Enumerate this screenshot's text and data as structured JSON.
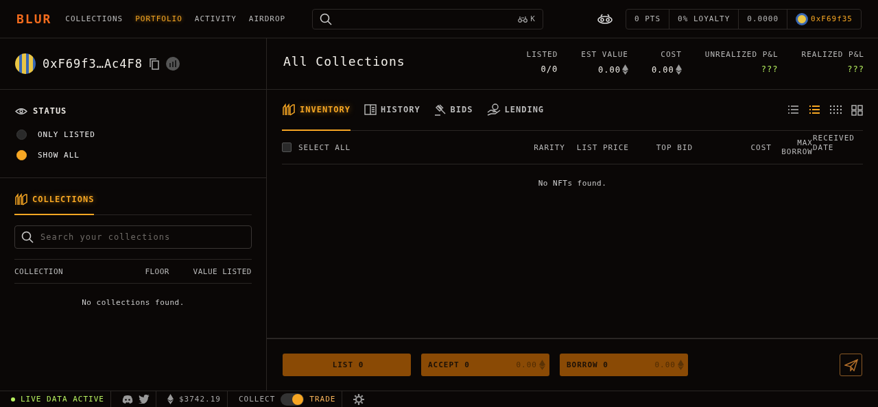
{
  "nav": {
    "logo": "BLUR",
    "links": [
      {
        "label": "COLLECTIONS",
        "selected": false
      },
      {
        "label": "PORTFOLIO",
        "selected": true
      },
      {
        "label": "ACTIVITY",
        "selected": false
      },
      {
        "label": "AIRDROP",
        "selected": false
      }
    ],
    "search_shortcut": "K",
    "stats": [
      "0 PTS",
      "0% LOYALTY",
      "0.0000"
    ],
    "wallet": "0xF69f35"
  },
  "profile": {
    "address": "0xF69f3…Ac4F8"
  },
  "status_filter": {
    "title": "STATUS",
    "options": [
      {
        "label": "ONLY LISTED",
        "selected": false
      },
      {
        "label": "SHOW ALL",
        "selected": true
      }
    ]
  },
  "collections_panel": {
    "tab": "COLLECTIONS",
    "search": {
      "placeholder": "Search your collections"
    },
    "columns": [
      "COLLECTION",
      "FLOOR",
      "VALUE LISTED"
    ],
    "empty": "No collections found."
  },
  "header": {
    "title": "All Collections",
    "stats": [
      {
        "label": "LISTED",
        "value": "0/0",
        "kind": "plain"
      },
      {
        "label": "EST VALUE",
        "value": "0.00",
        "kind": "eth"
      },
      {
        "label": "COST",
        "value": "0.00",
        "kind": "eth"
      },
      {
        "label": "UNREALIZED P&L",
        "value": "???",
        "kind": "pnl"
      },
      {
        "label": "REALIZED P&L",
        "value": "???",
        "kind": "pnl"
      }
    ]
  },
  "tabs": [
    {
      "label": "INVENTORY",
      "selected": true
    },
    {
      "label": "HISTORY",
      "selected": false
    },
    {
      "label": "BIDS",
      "selected": false
    },
    {
      "label": "LENDING",
      "selected": false
    }
  ],
  "view_modes": [
    {
      "selected": false
    },
    {
      "selected": true
    },
    {
      "selected": false
    },
    {
      "selected": false
    }
  ],
  "table": {
    "select_all": {
      "label": "SELECT ALL",
      "checked": false
    },
    "columns": [
      "RARITY",
      "LIST PRICE",
      "TOP BID",
      "COST",
      "MAX BORROW",
      "RECEIVED DATE"
    ],
    "empty": "No NFTs found."
  },
  "actions": [
    {
      "label": "LIST 0",
      "kind": "list"
    },
    {
      "label": "ACCEPT 0",
      "amount": "0.00",
      "kind": "amount"
    },
    {
      "label": "BORROW 0",
      "amount": "0.00",
      "kind": "amount"
    }
  ],
  "status_bar": {
    "live": "LIVE DATA ACTIVE",
    "eth_price": "$3742.19",
    "mode": {
      "left": "COLLECT",
      "right": "TRADE",
      "on": true
    }
  }
}
